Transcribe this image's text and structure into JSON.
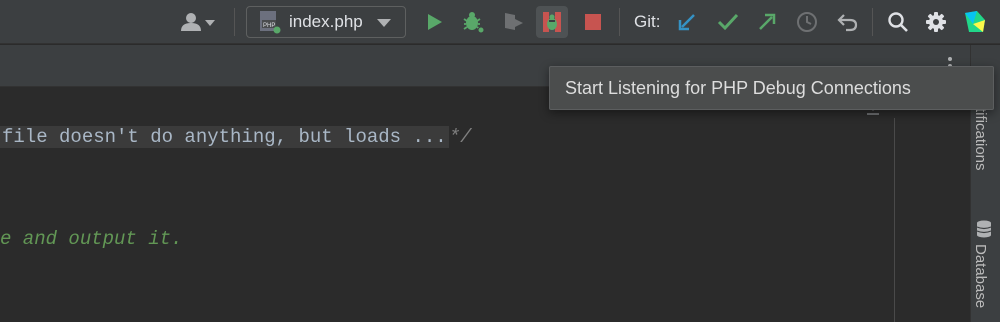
{
  "toolbar": {
    "run_config": {
      "label": "index.php"
    },
    "git_label": "Git:",
    "buttons": [
      {
        "icon": "user-icon"
      },
      {
        "icon": "run-icon",
        "color": "#59a869"
      },
      {
        "icon": "debug-icon",
        "color": "#59a869"
      },
      {
        "icon": "run-with-coverage-icon"
      },
      {
        "icon": "listen-php-debug-icon",
        "state": "highlighted"
      },
      {
        "icon": "stop-icon",
        "color": "#c75450"
      },
      {
        "icon": "git-update-icon",
        "color": "#3592c4"
      },
      {
        "icon": "git-commit-icon",
        "color": "#59a869"
      },
      {
        "icon": "git-push-icon",
        "color": "#59a869"
      },
      {
        "icon": "history-icon"
      },
      {
        "icon": "rollback-icon"
      },
      {
        "icon": "search-icon"
      },
      {
        "icon": "gear-icon"
      },
      {
        "icon": "jetbrains-product-icon"
      }
    ]
  },
  "tooltip": {
    "text": "Start Listening for PHP Debug Connections"
  },
  "editor": {
    "folded_text": "file doesn't do anything, but loads ...",
    "folded_end": "*/",
    "doc_comment": "e and output it."
  },
  "right_strip": {
    "notifications_label": "tifications",
    "database_label": "Database"
  },
  "colors": {
    "accent_green": "#59a869",
    "accent_blue": "#3592c4",
    "accent_red": "#c75450"
  }
}
